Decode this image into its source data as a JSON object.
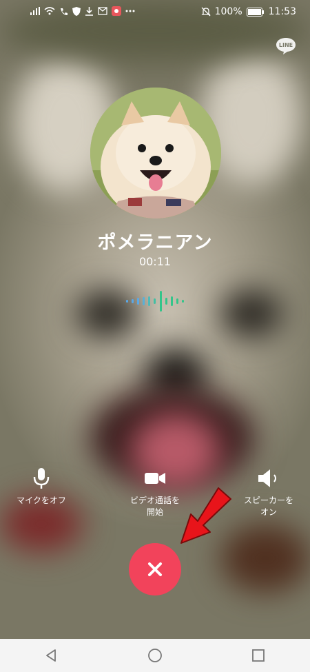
{
  "status_bar": {
    "battery_percent": "100%",
    "time": "11:53",
    "icons": [
      "signal-icon",
      "wifi-icon",
      "call-icon",
      "shield-icon",
      "download-icon",
      "mail-icon",
      "app-icon",
      "more-icon",
      "mute-icon",
      "battery-icon"
    ]
  },
  "brand": {
    "badge_text": "LINE"
  },
  "call": {
    "caller_name": "ポメラニアン",
    "duration": "00:11"
  },
  "controls": {
    "mic_label": "マイクをオフ",
    "video_label": "ビデオ通話を\n開始",
    "speaker_label": "スピーカーを\nオン"
  },
  "colors": {
    "end_call": "#f2435b",
    "arrow": "#e8141a",
    "wave_blue": "#5aa8e6",
    "wave_green": "#33c58a"
  },
  "navigation": {
    "buttons": [
      "back-icon",
      "home-icon",
      "recents-icon"
    ]
  }
}
